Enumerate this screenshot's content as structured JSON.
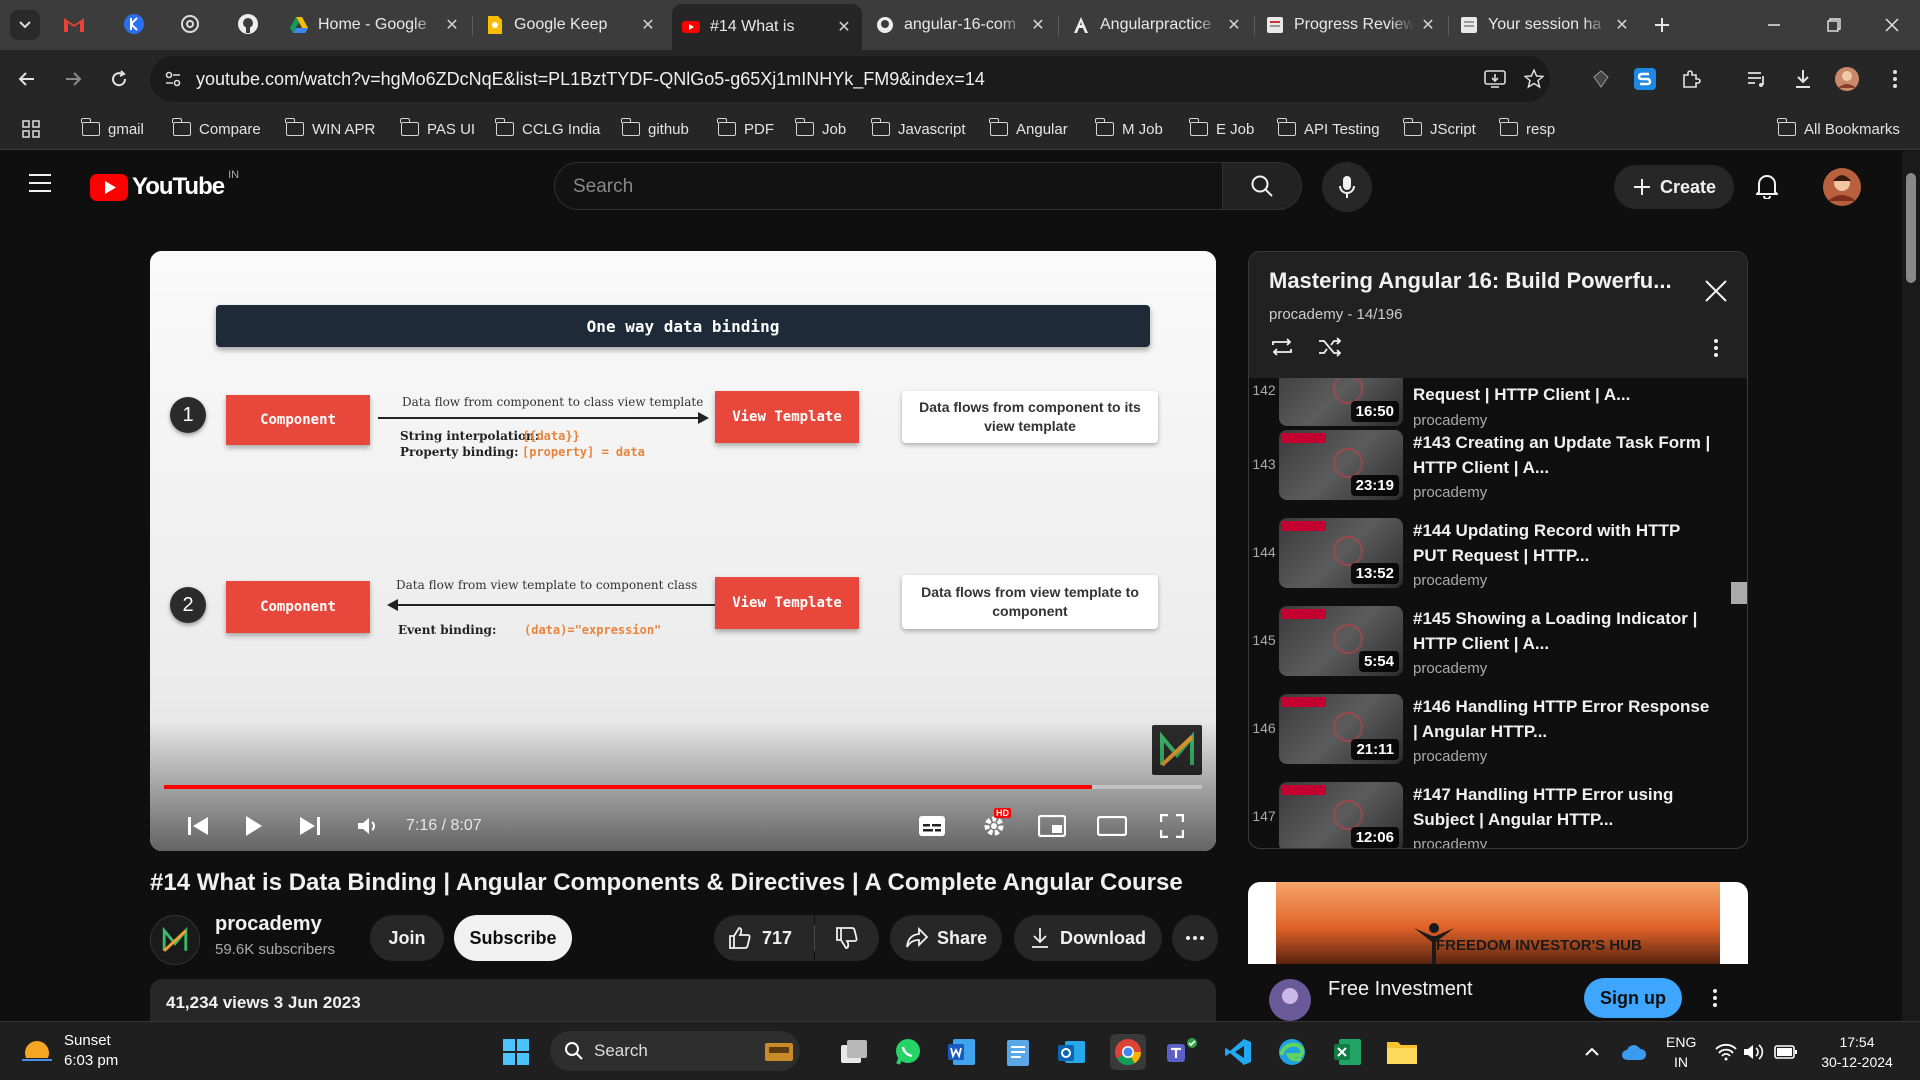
{
  "tabs": [
    {
      "title": "Home - Google",
      "favicon": "google-drive-icon",
      "active": false
    },
    {
      "title": "Google Keep",
      "favicon": "google-keep-icon",
      "active": false
    },
    {
      "title": "#14 What is",
      "favicon": "youtube-icon",
      "active": true
    },
    {
      "title": "angular-16-com",
      "favicon": "github-icon",
      "active": false
    },
    {
      "title": "Angularpractice",
      "favicon": "angular-a-icon",
      "active": false
    },
    {
      "title": "Progress Review",
      "favicon": "doc-icon",
      "active": false
    },
    {
      "title": "Your session ha",
      "favicon": "doc-icon",
      "active": false
    }
  ],
  "address": {
    "url": "youtube.com/watch?v=hgMo6ZDcNqE&list=PL1BztTYDF-QNlGo5-g65Xj1mINHYk_FM9&index=14"
  },
  "bookmarks": [
    "gmail",
    "Compare",
    "WIN APR",
    "PAS UI",
    "CCLG India",
    "github",
    "PDF",
    "Job",
    "Javascript",
    "Angular",
    "M Job",
    "E Job",
    "API Testing",
    "JScript",
    "resp"
  ],
  "all_bookmarks": "All Bookmarks",
  "youtube": {
    "logo_text": "YouTube",
    "region": "IN",
    "search_placeholder": "Search",
    "create_label": "Create"
  },
  "slide": {
    "title": "One way data binding",
    "row1": {
      "num": "1",
      "component": "Component",
      "flow_text": "Data flow from component to class view template",
      "label1": "String interpolation:",
      "code1": "{{data}}",
      "label2": "Property binding:",
      "code2": "[property] = data",
      "target": "View Template",
      "note": "Data flows from component to its view template"
    },
    "row2": {
      "num": "2",
      "component": "Component",
      "flow_text": "Data flow from view template to component class",
      "label1": "Event binding:",
      "code1": "(data)=\"expression\"",
      "target": "View Template",
      "note": "Data flows from view template to component"
    }
  },
  "player": {
    "time": "7:16 / 8:07",
    "progress": 0.894,
    "hd_badge": "HD"
  },
  "video": {
    "title": "#14 What is Data Binding | Angular Components & Directives | A Complete Angular Course",
    "channel": "procademy",
    "subscribers": "59.6K subscribers",
    "join": "Join",
    "subscribe": "Subscribe",
    "likes": "717",
    "share": "Share",
    "download": "Download",
    "views_date": "41,234 views  3 Jun 2023"
  },
  "playlist": {
    "title": "Mastering Angular 16: Build Powerfu...",
    "subtitle": "procademy - 14/196",
    "items": [
      {
        "index": "142",
        "title": "Request | HTTP Client | A...",
        "channel": "procademy",
        "duration": "16:50"
      },
      {
        "index": "143",
        "title": "#143 Creating an Update Task Form | HTTP Client | A...",
        "channel": "procademy",
        "duration": "23:19"
      },
      {
        "index": "144",
        "title": "#144 Updating Record with HTTP PUT Request | HTTP...",
        "channel": "procademy",
        "duration": "13:52"
      },
      {
        "index": "145",
        "title": "#145 Showing a Loading Indicator | HTTP Client | A...",
        "channel": "procademy",
        "duration": "5:54"
      },
      {
        "index": "146",
        "title": "#146 Handling HTTP Error Response | Angular HTTP...",
        "channel": "procademy",
        "duration": "21:11"
      },
      {
        "index": "147",
        "title": "#147 Handling HTTP Error using Subject | Angular HTTP...",
        "channel": "procademy",
        "duration": "12:06"
      }
    ]
  },
  "ad": {
    "banner_text": "FREEDOM INVESTOR'S HUB",
    "title": "Free Investment",
    "cta": "Sign up"
  },
  "taskbar": {
    "weather_label": "Sunset",
    "weather_time": "6:03 pm",
    "search": "Search",
    "lang1": "ENG",
    "lang2": "IN",
    "clock": "17:54",
    "date": "30-12-2024"
  },
  "colors": {
    "accent_red": "#ff0000",
    "slide_red": "#e8483c",
    "code_orange": "#e8843c",
    "link_blue": "#3ea6ff"
  }
}
